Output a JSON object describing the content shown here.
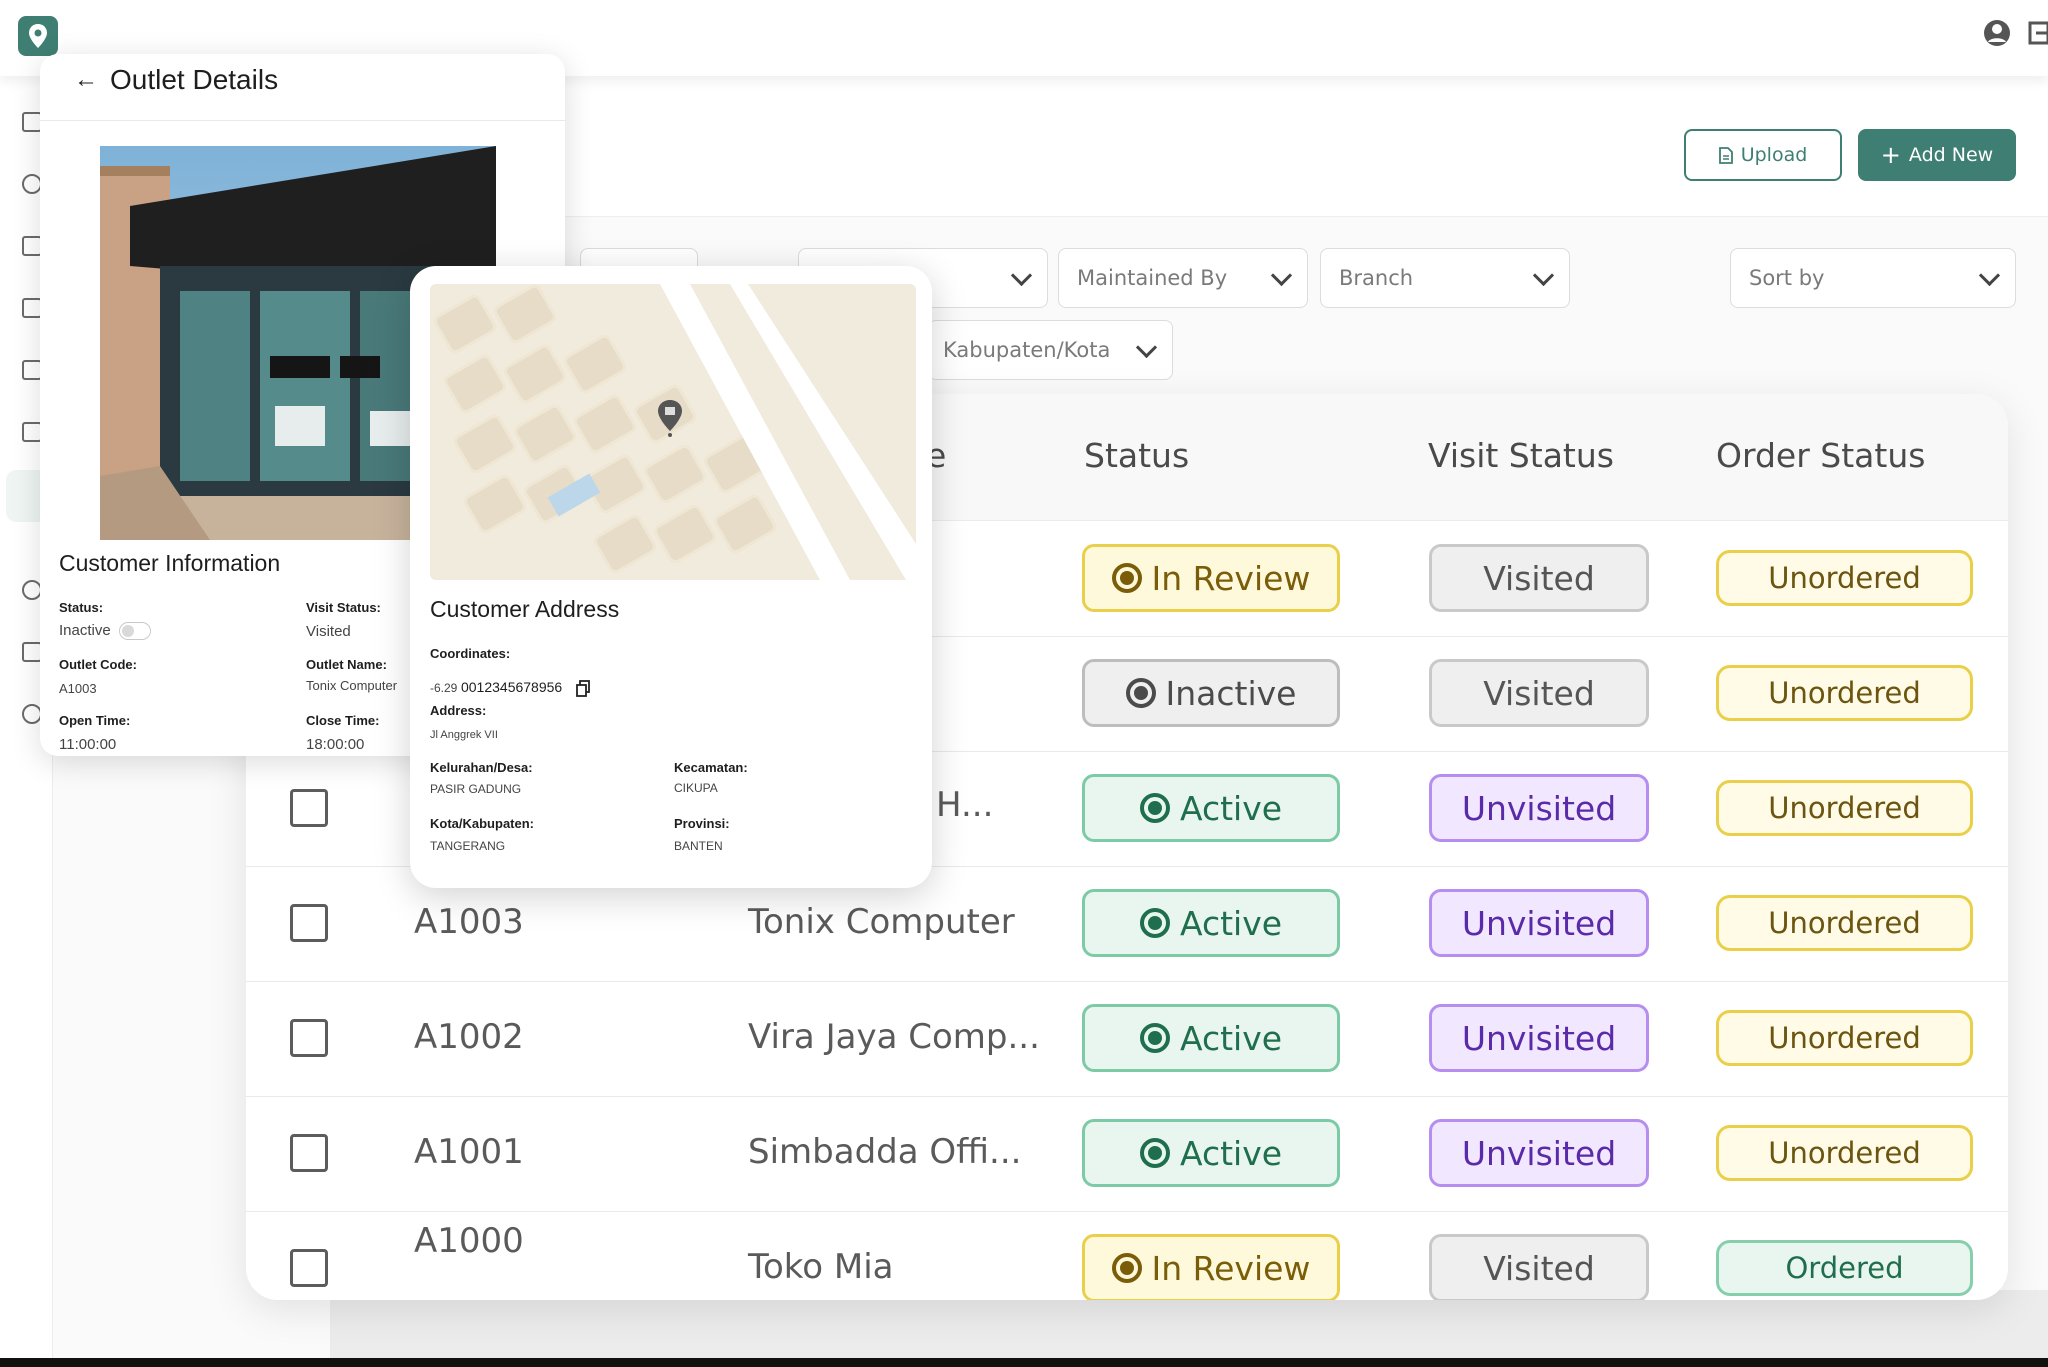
{
  "header": {
    "upload_label": "Upload",
    "add_new_label": "Add New"
  },
  "filters": {
    "maintained_by": "Maintained By",
    "branch": "Branch",
    "sort_by": "Sort by",
    "kabupaten_kota": "Kabupaten/Kota"
  },
  "table": {
    "partial_name_header": "e",
    "status_header": "Status",
    "visit_status_header": "Visit Status",
    "order_status_header": "Order Status",
    "rows": [
      {
        "code": "",
        "name": "",
        "status": "In Review",
        "visit": "Visited",
        "order": "Unordered"
      },
      {
        "code": "",
        "name": "",
        "status": "Inactive",
        "visit": "Visited",
        "order": "Unordered"
      },
      {
        "code": "",
        "name": "H...",
        "status": "Active",
        "visit": "Unvisited",
        "order": "Unordered"
      },
      {
        "code": "A1003",
        "name": "Tonix Computer",
        "status": "Active",
        "visit": "Unvisited",
        "order": "Unordered"
      },
      {
        "code": "A1002",
        "name": "Vira Jaya Comp...",
        "status": "Active",
        "visit": "Unvisited",
        "order": "Unordered"
      },
      {
        "code": "A1001",
        "name": "Simbadda Offi...",
        "status": "Active",
        "visit": "Unvisited",
        "order": "Unordered"
      },
      {
        "code": "A1000",
        "name": "Toko Mia",
        "status": "In Review",
        "visit": "Visited",
        "order": "Ordered"
      }
    ]
  },
  "details": {
    "title": "Outlet Details",
    "section_title": "Customer Information",
    "status_label": "Status:",
    "status_value": "Inactive",
    "visit_status_label": "Visit Status:",
    "visit_status_value": "Visited",
    "outlet_code_label": "Outlet Code:",
    "outlet_code_value": "A1003",
    "outlet_name_label": "Outlet Name:",
    "outlet_name_value": "Tonix Computer",
    "open_time_label": "Open Time:",
    "open_time_value": "11:00:00",
    "close_time_label": "Close Time:",
    "close_time_value": "18:00:00"
  },
  "address": {
    "title": "Customer Address",
    "coordinates_label": "Coordinates:",
    "coordinates_prefix": "-6.29",
    "coordinates_value": "0012345678956",
    "address_label": "Address:",
    "address_value": "Jl Anggrek VII",
    "kelurahan_label": "Kelurahan/Desa:",
    "kelurahan_value": "PASIR GADUNG",
    "kecamatan_label": "Kecamatan:",
    "kecamatan_value": "CIKUPA",
    "kota_label": "Kota/Kabupaten:",
    "kota_value": "TANGERANG",
    "provinsi_label": "Provinsi:",
    "provinsi_value": "BANTEN"
  },
  "colors": {
    "brand": "#3f7f73",
    "active": "#1f6e4e",
    "in_review": "#7a5d08",
    "unvisited": "#5a2aa8"
  }
}
